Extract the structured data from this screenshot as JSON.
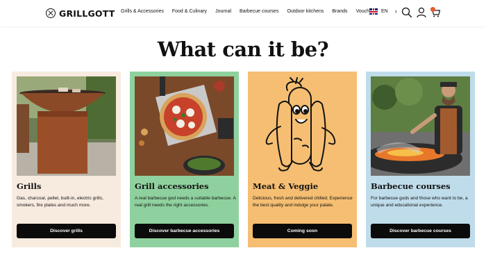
{
  "header": {
    "logo": "GRILLGOTT",
    "nav": [
      "Grills & Accessories",
      "Food & Culinary",
      "Journal",
      "Barbecue courses",
      "Outdoor kitchens",
      "Brands",
      "Vouchers"
    ],
    "language": "EN",
    "icons": [
      "search-icon",
      "user-icon",
      "cart-icon"
    ],
    "badge_color": "#e85c2c"
  },
  "main": {
    "title": "What can it be?",
    "cards": [
      {
        "title": "Grills",
        "description": "Gas, charcoal, pellet, built-in, electric grills, smokers, fire plates and much more.",
        "button": "Discover grills",
        "background": "#f7ebe0"
      },
      {
        "title": "Grill accessories",
        "description": "A real barbecue god needs a suitable barbecue. A real grill needs the right accessories.",
        "button": "Discover barbecue accessories",
        "background": "#8fd19e"
      },
      {
        "title": "Meat & Veggie",
        "description": "Delicious, fresh and delivered chilled. Experience the best quality and indulge your palate.",
        "button": "Coming soon",
        "background": "#f5be72"
      },
      {
        "title": "Barbecue courses",
        "description": "For barbecue gods and those who want to be, a unique and educational experience.",
        "button": "Discover barbecue courses",
        "background": "#bfdcea"
      }
    ]
  }
}
